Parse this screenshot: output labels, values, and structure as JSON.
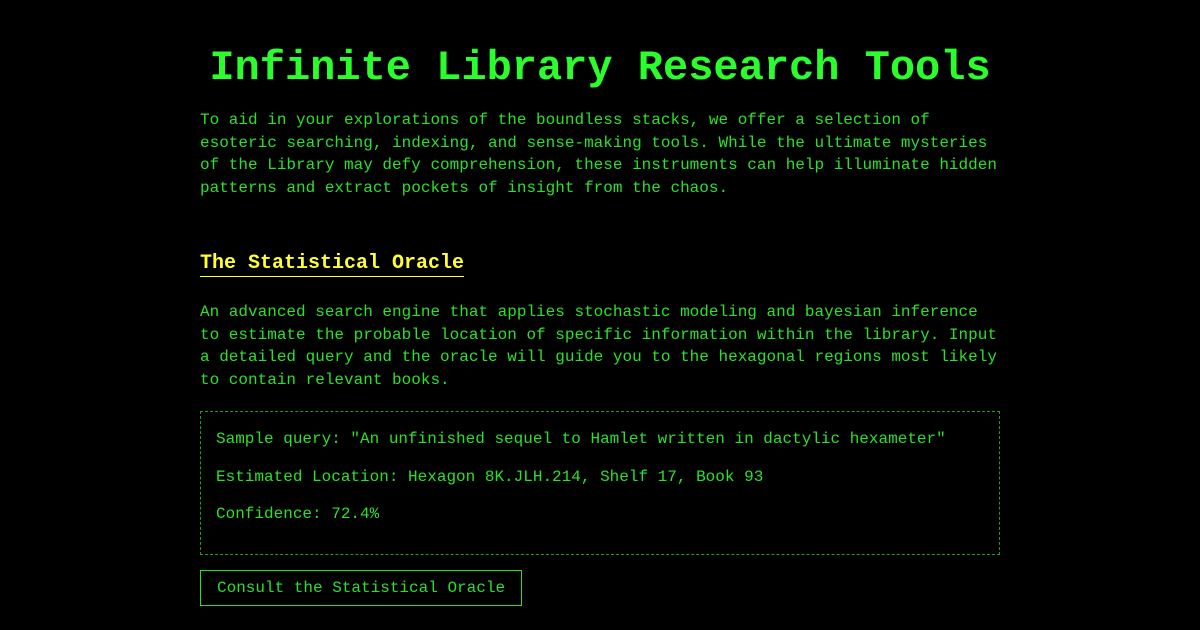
{
  "page": {
    "title": "Infinite Library Research Tools",
    "intro": "To aid in your explorations of the boundless stacks, we offer a selection of esoteric searching, indexing, and sense-making tools. While the ultimate mysteries of the Library may defy comprehension, these instruments can help illuminate hidden patterns and extract pockets of insight from the chaos."
  },
  "tool": {
    "heading": "The Statistical Oracle",
    "description": "An advanced search engine that applies stochastic modeling and bayesian inference to estimate the probable location of specific information within the library. Input a detailed query and the oracle will guide you to the hexagonal regions most likely to contain relevant books.",
    "sample": {
      "query": "Sample query: \"An unfinished sequel to Hamlet written in dactylic hexameter\"",
      "location": "Estimated Location: Hexagon 8K.JLH.214, Shelf 17, Book 93",
      "confidence": "Confidence: 72.4%"
    },
    "button_label": "Consult the Statistical Oracle"
  },
  "colors": {
    "background": "#000000",
    "title_green": "#2bff2b",
    "text_green": "#2be02b",
    "heading_yellow": "#ffff33"
  }
}
